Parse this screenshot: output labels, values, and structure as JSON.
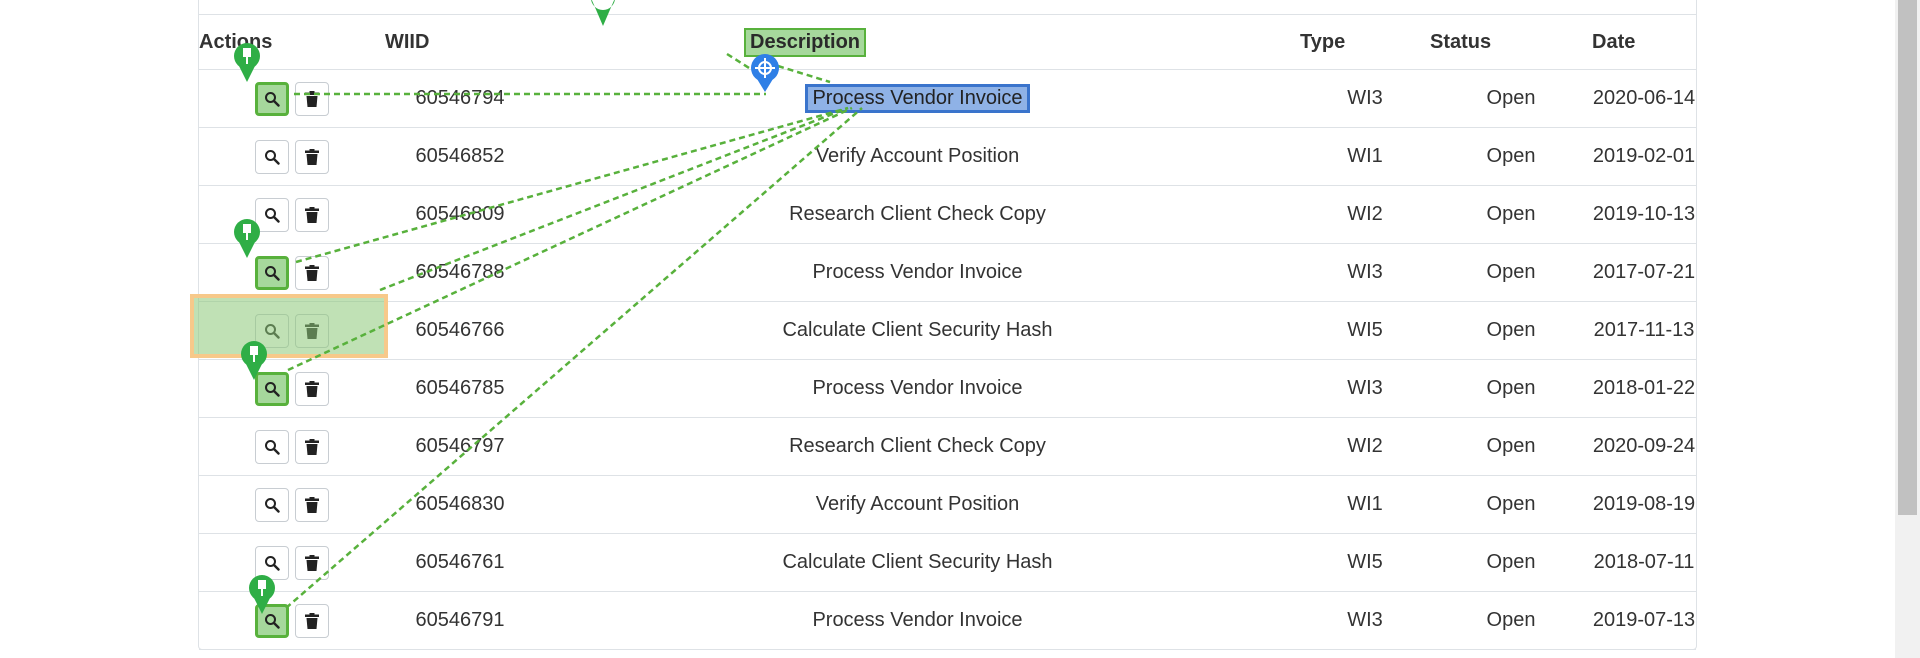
{
  "table": {
    "headers": {
      "actions": "Actions",
      "wiid": "WIID",
      "description": "Description",
      "type": "Type",
      "status": "Status",
      "date": "Date"
    },
    "rows": [
      {
        "wiid": "60546794",
        "description": "Process Vendor Invoice",
        "type": "WI3",
        "status": "Open",
        "date": "2020-06-14"
      },
      {
        "wiid": "60546852",
        "description": "Verify Account Position",
        "type": "WI1",
        "status": "Open",
        "date": "2019-02-01"
      },
      {
        "wiid": "60546809",
        "description": "Research Client Check Copy",
        "type": "WI2",
        "status": "Open",
        "date": "2019-10-13"
      },
      {
        "wiid": "60546788",
        "description": "Process Vendor Invoice",
        "type": "WI3",
        "status": "Open",
        "date": "2017-07-21"
      },
      {
        "wiid": "60546766",
        "description": "Calculate Client Security Hash",
        "type": "WI5",
        "status": "Open",
        "date": "2017-11-13"
      },
      {
        "wiid": "60546785",
        "description": "Process Vendor Invoice",
        "type": "WI3",
        "status": "Open",
        "date": "2018-01-22"
      },
      {
        "wiid": "60546797",
        "description": "Research Client Check Copy",
        "type": "WI2",
        "status": "Open",
        "date": "2020-09-24"
      },
      {
        "wiid": "60546830",
        "description": "Verify Account Position",
        "type": "WI1",
        "status": "Open",
        "date": "2019-08-19"
      },
      {
        "wiid": "60546761",
        "description": "Calculate Client Security Hash",
        "type": "WI5",
        "status": "Open",
        "date": "2018-07-11"
      },
      {
        "wiid": "60546791",
        "description": "Process Vendor Invoice",
        "type": "WI3",
        "status": "Open",
        "date": "2019-07-13"
      }
    ]
  },
  "icons": {
    "view": "search-icon",
    "delete": "trash-icon",
    "pin": "pin-icon",
    "target": "crosshair-icon"
  },
  "colors": {
    "highlight_green": "#a6d89c",
    "highlight_green_border": "#58b13c",
    "selection_blue": "#8fb2e6",
    "selection_blue_border": "#3a74cc",
    "row_highlight_border": "#f7c98a"
  }
}
